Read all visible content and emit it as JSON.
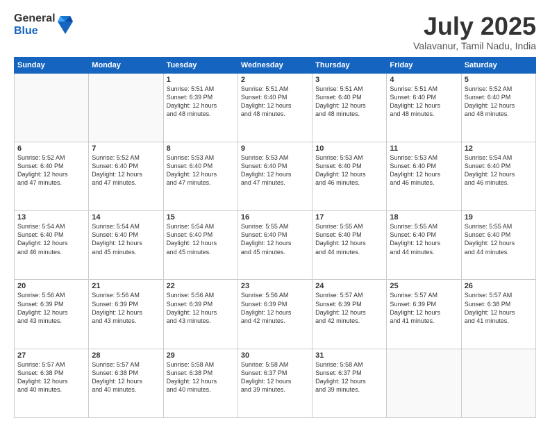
{
  "header": {
    "logo_general": "General",
    "logo_blue": "Blue",
    "month_title": "July 2025",
    "subtitle": "Valavanur, Tamil Nadu, India"
  },
  "weekdays": [
    "Sunday",
    "Monday",
    "Tuesday",
    "Wednesday",
    "Thursday",
    "Friday",
    "Saturday"
  ],
  "weeks": [
    [
      {
        "day": "",
        "info": ""
      },
      {
        "day": "",
        "info": ""
      },
      {
        "day": "1",
        "info": "Sunrise: 5:51 AM\nSunset: 6:39 PM\nDaylight: 12 hours\nand 48 minutes."
      },
      {
        "day": "2",
        "info": "Sunrise: 5:51 AM\nSunset: 6:40 PM\nDaylight: 12 hours\nand 48 minutes."
      },
      {
        "day": "3",
        "info": "Sunrise: 5:51 AM\nSunset: 6:40 PM\nDaylight: 12 hours\nand 48 minutes."
      },
      {
        "day": "4",
        "info": "Sunrise: 5:51 AM\nSunset: 6:40 PM\nDaylight: 12 hours\nand 48 minutes."
      },
      {
        "day": "5",
        "info": "Sunrise: 5:52 AM\nSunset: 6:40 PM\nDaylight: 12 hours\nand 48 minutes."
      }
    ],
    [
      {
        "day": "6",
        "info": "Sunrise: 5:52 AM\nSunset: 6:40 PM\nDaylight: 12 hours\nand 47 minutes."
      },
      {
        "day": "7",
        "info": "Sunrise: 5:52 AM\nSunset: 6:40 PM\nDaylight: 12 hours\nand 47 minutes."
      },
      {
        "day": "8",
        "info": "Sunrise: 5:53 AM\nSunset: 6:40 PM\nDaylight: 12 hours\nand 47 minutes."
      },
      {
        "day": "9",
        "info": "Sunrise: 5:53 AM\nSunset: 6:40 PM\nDaylight: 12 hours\nand 47 minutes."
      },
      {
        "day": "10",
        "info": "Sunrise: 5:53 AM\nSunset: 6:40 PM\nDaylight: 12 hours\nand 46 minutes."
      },
      {
        "day": "11",
        "info": "Sunrise: 5:53 AM\nSunset: 6:40 PM\nDaylight: 12 hours\nand 46 minutes."
      },
      {
        "day": "12",
        "info": "Sunrise: 5:54 AM\nSunset: 6:40 PM\nDaylight: 12 hours\nand 46 minutes."
      }
    ],
    [
      {
        "day": "13",
        "info": "Sunrise: 5:54 AM\nSunset: 6:40 PM\nDaylight: 12 hours\nand 46 minutes."
      },
      {
        "day": "14",
        "info": "Sunrise: 5:54 AM\nSunset: 6:40 PM\nDaylight: 12 hours\nand 45 minutes."
      },
      {
        "day": "15",
        "info": "Sunrise: 5:54 AM\nSunset: 6:40 PM\nDaylight: 12 hours\nand 45 minutes."
      },
      {
        "day": "16",
        "info": "Sunrise: 5:55 AM\nSunset: 6:40 PM\nDaylight: 12 hours\nand 45 minutes."
      },
      {
        "day": "17",
        "info": "Sunrise: 5:55 AM\nSunset: 6:40 PM\nDaylight: 12 hours\nand 44 minutes."
      },
      {
        "day": "18",
        "info": "Sunrise: 5:55 AM\nSunset: 6:40 PM\nDaylight: 12 hours\nand 44 minutes."
      },
      {
        "day": "19",
        "info": "Sunrise: 5:55 AM\nSunset: 6:40 PM\nDaylight: 12 hours\nand 44 minutes."
      }
    ],
    [
      {
        "day": "20",
        "info": "Sunrise: 5:56 AM\nSunset: 6:39 PM\nDaylight: 12 hours\nand 43 minutes."
      },
      {
        "day": "21",
        "info": "Sunrise: 5:56 AM\nSunset: 6:39 PM\nDaylight: 12 hours\nand 43 minutes."
      },
      {
        "day": "22",
        "info": "Sunrise: 5:56 AM\nSunset: 6:39 PM\nDaylight: 12 hours\nand 43 minutes."
      },
      {
        "day": "23",
        "info": "Sunrise: 5:56 AM\nSunset: 6:39 PM\nDaylight: 12 hours\nand 42 minutes."
      },
      {
        "day": "24",
        "info": "Sunrise: 5:57 AM\nSunset: 6:39 PM\nDaylight: 12 hours\nand 42 minutes."
      },
      {
        "day": "25",
        "info": "Sunrise: 5:57 AM\nSunset: 6:39 PM\nDaylight: 12 hours\nand 41 minutes."
      },
      {
        "day": "26",
        "info": "Sunrise: 5:57 AM\nSunset: 6:38 PM\nDaylight: 12 hours\nand 41 minutes."
      }
    ],
    [
      {
        "day": "27",
        "info": "Sunrise: 5:57 AM\nSunset: 6:38 PM\nDaylight: 12 hours\nand 40 minutes."
      },
      {
        "day": "28",
        "info": "Sunrise: 5:57 AM\nSunset: 6:38 PM\nDaylight: 12 hours\nand 40 minutes."
      },
      {
        "day": "29",
        "info": "Sunrise: 5:58 AM\nSunset: 6:38 PM\nDaylight: 12 hours\nand 40 minutes."
      },
      {
        "day": "30",
        "info": "Sunrise: 5:58 AM\nSunset: 6:37 PM\nDaylight: 12 hours\nand 39 minutes."
      },
      {
        "day": "31",
        "info": "Sunrise: 5:58 AM\nSunset: 6:37 PM\nDaylight: 12 hours\nand 39 minutes."
      },
      {
        "day": "",
        "info": ""
      },
      {
        "day": "",
        "info": ""
      }
    ]
  ]
}
